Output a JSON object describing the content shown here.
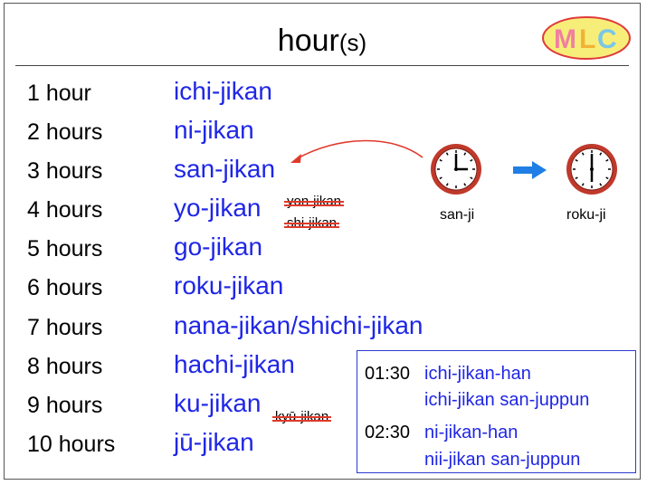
{
  "title": {
    "main": "hour",
    "paren": "(s)"
  },
  "logo": {
    "text": "MLC",
    "colors": [
      "#f07fa0",
      "#f2c744",
      "#79c6e8"
    ]
  },
  "hours": [
    {
      "num": "1 hour",
      "jp": "ichi-jikan"
    },
    {
      "num": "2 hours",
      "jp": "ni-jikan"
    },
    {
      "num": "3 hours",
      "jp": "san-jikan"
    },
    {
      "num": "4 hours",
      "jp": "yo-jikan"
    },
    {
      "num": "5 hours",
      "jp": "go-jikan"
    },
    {
      "num": "6 hours",
      "jp": "roku-jikan"
    },
    {
      "num": "7 hours",
      "jp": "nana-jikan/shichi-jikan"
    },
    {
      "num": "8 hours",
      "jp": "hachi-jikan"
    },
    {
      "num": "9 hours",
      "jp": "ku-jikan"
    },
    {
      "num": "10 hours",
      "jp": "jū-jikan"
    }
  ],
  "struck": {
    "yon": "yon-jikan",
    "shi": "shi-jikan",
    "kyu": "kyū-jikan"
  },
  "clocks": {
    "left_label": "san-ji",
    "right_label": "roku-ji"
  },
  "box": {
    "t1": "01:30",
    "l1a": "ichi-jikan-han",
    "l1b": "ichi-jikan san-juppun",
    "t2": "02:30",
    "l2a": "ni-jikan-han",
    "l2b": "nii-jikan san-juppun"
  },
  "colors": {
    "japanese_text": "#1f26e6",
    "strike": "#e0392b",
    "clock_rim": "#c0392b",
    "arrow_blue": "#1f7fe6"
  }
}
